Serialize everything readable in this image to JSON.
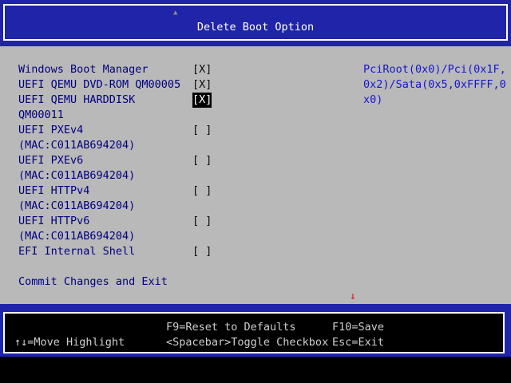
{
  "header": {
    "title": "Delete Boot Option",
    "scroll_up_icon": "up-arrow-icon"
  },
  "boot_options": [
    {
      "label": "Windows Boot Manager",
      "checkbox": "[X]",
      "checked": true,
      "selected": false
    },
    {
      "label": "UEFI QEMU DVD-ROM QM00005",
      "checkbox": "[X]",
      "checked": true,
      "selected": false
    },
    {
      "label_line1": "UEFI QEMU HARDDISK",
      "label_line2": "QM00011",
      "checkbox": "[X]",
      "checked": true,
      "selected": true
    },
    {
      "label_line1": "UEFI PXEv4",
      "label_line2": "(MAC:C011AB694204)",
      "checkbox": "[ ]",
      "checked": false,
      "selected": false
    },
    {
      "label_line1": "UEFI PXEv6",
      "label_line2": "(MAC:C011AB694204)",
      "checkbox": "[ ]",
      "checked": false,
      "selected": false
    },
    {
      "label_line1": "UEFI HTTPv4",
      "label_line2": "(MAC:C011AB694204)",
      "checkbox": "[ ]",
      "checked": false,
      "selected": false
    },
    {
      "label_line1": "UEFI HTTPv6",
      "label_line2": "(MAC:C011AB694204)",
      "checkbox": "[ ]",
      "checked": false,
      "selected": false
    },
    {
      "label": "EFI Internal Shell",
      "checkbox": "[ ]",
      "checked": false,
      "selected": false
    }
  ],
  "commit_label": "Commit Changes and Exit",
  "help_text": {
    "line1": "PciRoot(0x0)/Pci(0x1F,",
    "line2": "0x2)/Sata(0x5,0xFFFF,0",
    "line3": "x0)"
  },
  "scroll_down_icon": "down-arrow-icon",
  "footer": {
    "f9": "F9=Reset to Defaults",
    "f10": "F10=Save",
    "move": "↑↓=Move Highlight",
    "toggle": "<Spacebar>Toggle Checkbox",
    "esc": "Esc=Exit"
  },
  "colors": {
    "title_band": "#1f24a8",
    "main_bg": "#b9b9b9",
    "label_text": "#000080",
    "help_text": "#1616d4",
    "selected_bg": "#000000",
    "selected_fg": "#ffffff",
    "scroll_arrow": "#e01010",
    "footer_text": "#cfcfcf"
  }
}
